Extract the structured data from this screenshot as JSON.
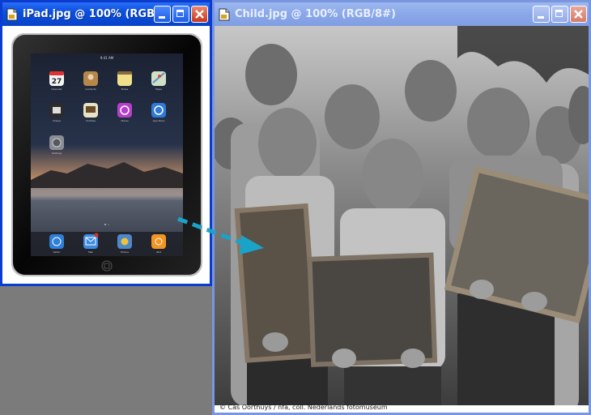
{
  "windows": {
    "ipad": {
      "title": "iPad.jpg @ 100% (RGB/..."
    },
    "child": {
      "title": "Child.jpg @ 100% (RGB/8#)"
    }
  },
  "ipad_screen": {
    "status_time": "9:41 AM",
    "calendar_date": "27",
    "apps": [
      "Calendar",
      "Contacts",
      "Notes",
      "Maps",
      "Videos",
      "YouTube",
      "iTunes",
      "App Store",
      "Settings"
    ],
    "dock": [
      "Safari",
      "Mail",
      "Photos",
      "iPod"
    ]
  },
  "photo": {
    "credit": "© Cas Oorthuys / nfa, coll. Nederlands fotomuseum"
  },
  "colors": {
    "active_border": "#0a3ccf",
    "inactive_border": "#7a96df",
    "arrow": "#1aa3c9",
    "desktop": "#7b7b7b"
  },
  "icons": [
    "document-icon",
    "minimize-icon",
    "maximize-icon",
    "close-icon",
    "arrow-icon"
  ]
}
